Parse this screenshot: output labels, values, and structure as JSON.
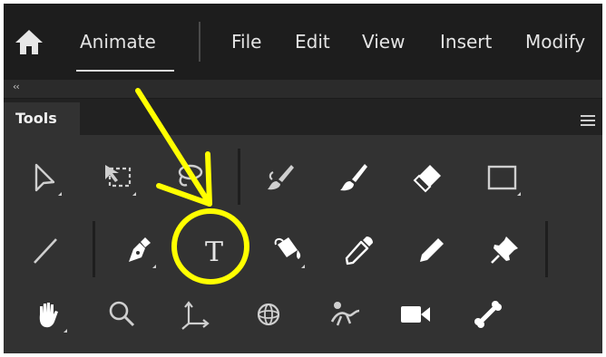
{
  "topbar": {
    "home_icon": "home-icon",
    "app_name": "Animate",
    "menu": [
      "File",
      "Edit",
      "View",
      "Insert",
      "Modify"
    ]
  },
  "panel": {
    "collapse_label": "‹‹",
    "tab_label": "Tools",
    "menu_icon": "hamburger-menu-icon"
  },
  "tools": {
    "row1": [
      "selection-tool-icon",
      "free-transform-tool-icon",
      "lasso-tool-icon",
      "paint-brush-tool-icon",
      "brush-tool-icon",
      "eraser-tool-icon",
      "rectangle-tool-icon"
    ],
    "row2": [
      "line-tool-icon",
      "pen-tool-icon",
      "text-tool-icon",
      "paint-bucket-tool-icon",
      "eyedropper-tool-icon",
      "pencil-tool-icon",
      "pin-tool-icon"
    ],
    "row3": [
      "hand-tool-icon",
      "zoom-tool-icon",
      "bone-axis-tool-icon",
      "3d-rotation-tool-icon",
      "puppet-warp-tool-icon",
      "camera-tool-icon",
      "bone-tool-icon"
    ],
    "text_tool_glyph": "T"
  },
  "annotation": {
    "color": "#ffff00",
    "shape": "arrow pointing to circled text tool"
  }
}
